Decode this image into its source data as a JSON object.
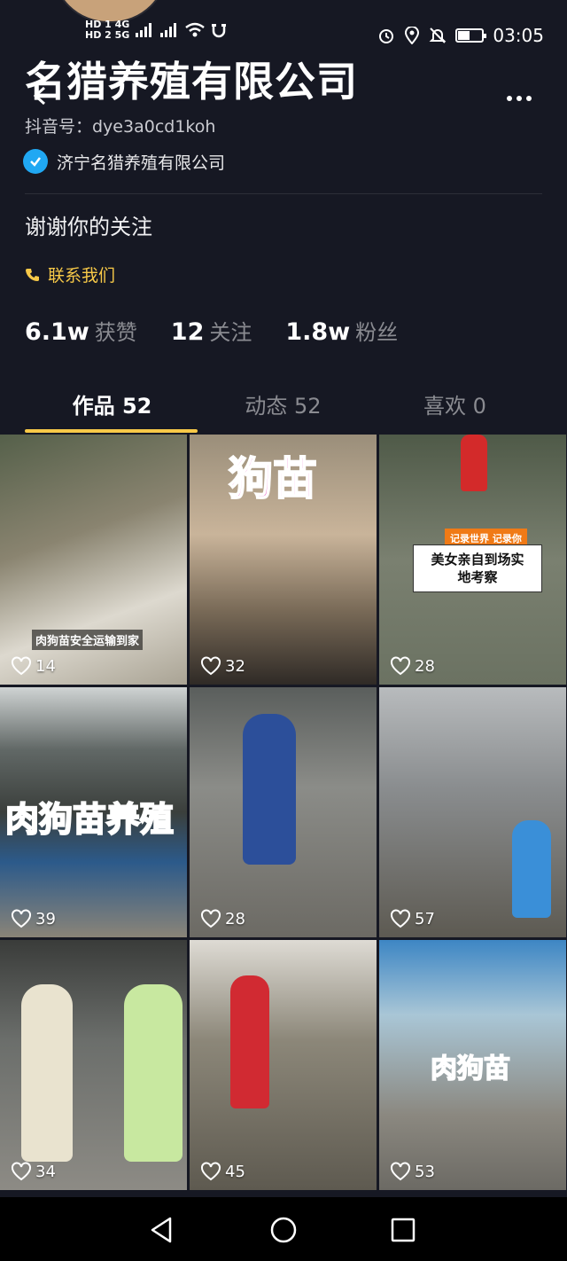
{
  "status_bar": {
    "network_left": "HD 1 4G",
    "network_left2": "HD 2 5G",
    "time": "03:05",
    "battery_level": 0.45
  },
  "profile": {
    "name": "名猎养殖有限公司",
    "douyin_id": "抖音号：dye3a0cd1koh",
    "verified_name": "济宁名猎养殖有限公司",
    "bio": "谢谢你的关注",
    "contact_label": "联系我们"
  },
  "stats": [
    {
      "value": "6.1w",
      "label": "获赞"
    },
    {
      "value": "12",
      "label": "关注"
    },
    {
      "value": "1.8w",
      "label": "粉丝"
    }
  ],
  "tabs": [
    {
      "label": "作品 52",
      "active": true
    },
    {
      "label": "动态 52",
      "active": false
    },
    {
      "label": "喜欢 0",
      "active": false
    }
  ],
  "videos": [
    {
      "likes": "14",
      "caption": "肉狗苗安全运输到家",
      "bg": "#7a7560"
    },
    {
      "likes": "32",
      "caption": "狗苗",
      "bg": "#8a7a63"
    },
    {
      "likes": "28",
      "caption_line1": "记录世界 记录你",
      "caption_line2": "美女亲自到场实",
      "caption_line3": "地考察",
      "bg": "#5b6351"
    },
    {
      "likes": "39",
      "caption": "肉狗苗养殖",
      "bg": "#5a5f5a"
    },
    {
      "likes": "28",
      "caption": "",
      "bg": "#6c6e6a"
    },
    {
      "likes": "57",
      "caption": "",
      "bg": "#7d7b75"
    },
    {
      "likes": "34",
      "caption": "",
      "bg": "#6a6862"
    },
    {
      "likes": "45",
      "caption": "",
      "bg": "#74705f"
    },
    {
      "likes": "53",
      "caption": "肉狗苗",
      "bg": "#6f7c86"
    }
  ],
  "icons": {
    "back": "chevron-left-icon",
    "more": "more-dots-icon",
    "verified": "check-badge-icon",
    "phone": "phone-icon",
    "heart": "heart-outline-icon"
  },
  "colors": {
    "background": "#161823",
    "accent": "#f7c948",
    "verified_blue": "#20a8f3"
  }
}
